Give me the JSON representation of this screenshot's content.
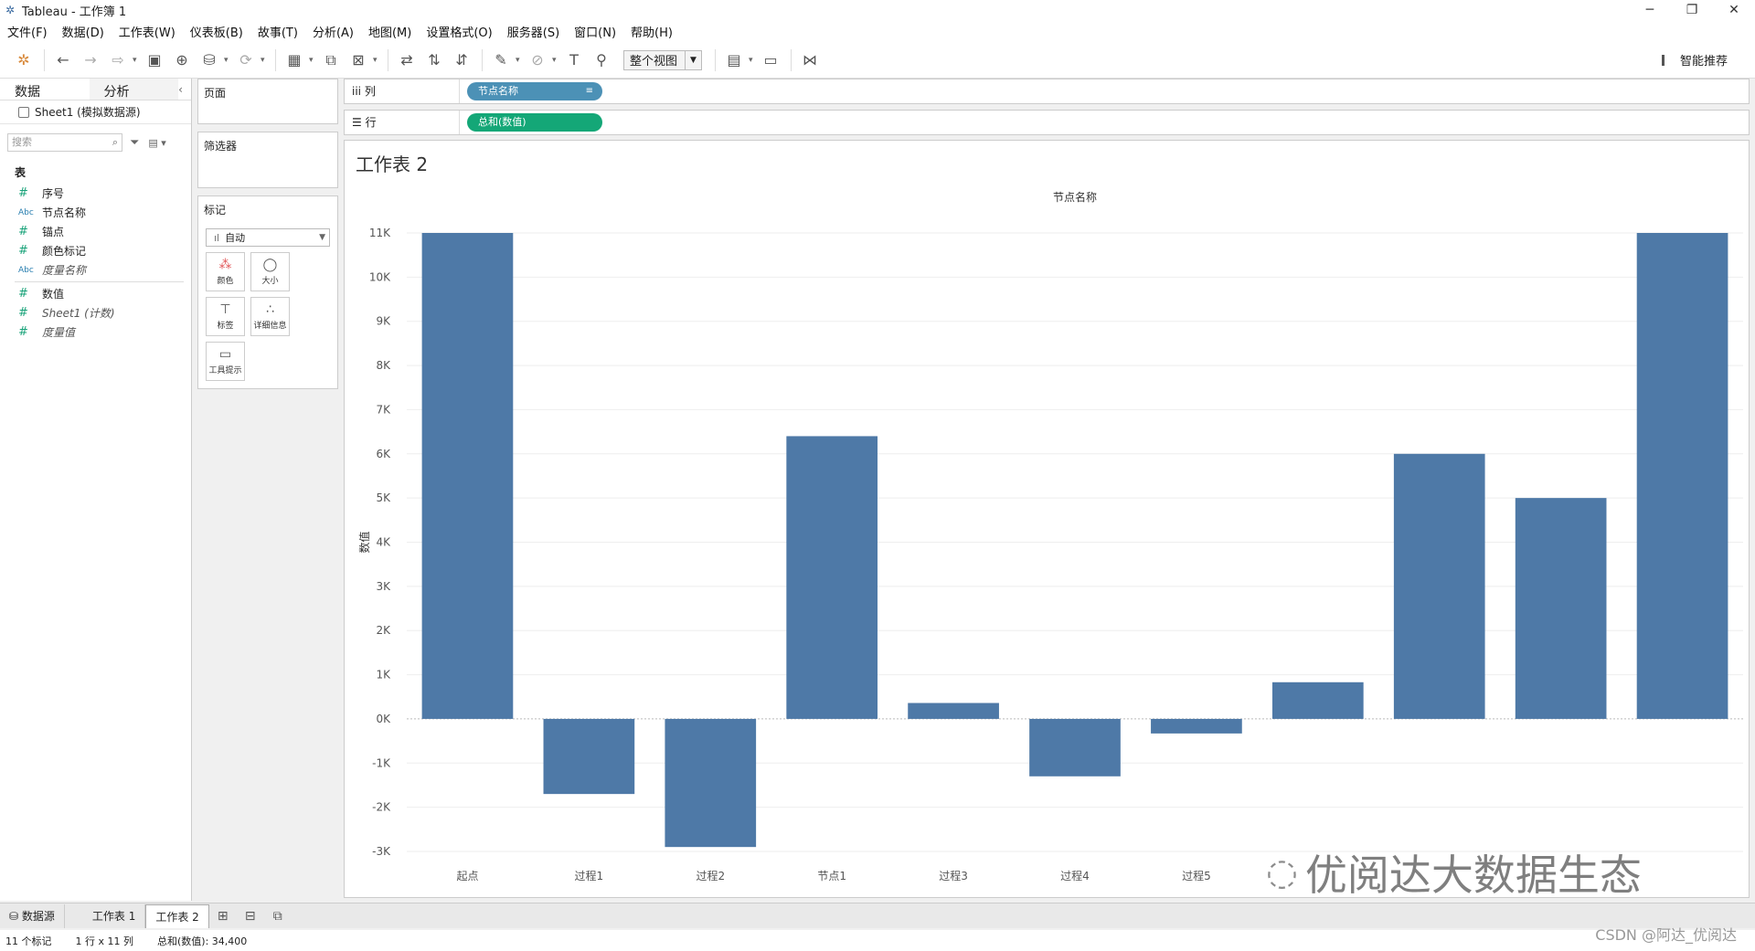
{
  "window": {
    "title": "Tableau - 工作簿 1",
    "controls": [
      "─",
      "❐",
      "✕"
    ]
  },
  "menu": [
    "文件(F)",
    "数据(D)",
    "工作表(W)",
    "仪表板(B)",
    "故事(T)",
    "分析(A)",
    "地图(M)",
    "设置格式(O)",
    "服务器(S)",
    "窗口(N)",
    "帮助(H)"
  ],
  "toolbar": {
    "view_select": "整个视图",
    "smart": "智能推荐"
  },
  "left_panel": {
    "tabs": [
      "数据",
      "分析"
    ],
    "datasource": "Sheet1 (模拟数据源)",
    "search_placeholder": "搜索",
    "section_title": "表",
    "dimensions": [
      {
        "type": "#",
        "name": "序号",
        "italic": false
      },
      {
        "type": "Abc",
        "name": "节点名称",
        "italic": false
      },
      {
        "type": "#",
        "name": "锚点",
        "italic": false
      },
      {
        "type": "#",
        "name": "颜色标记",
        "italic": false
      },
      {
        "type": "Abc",
        "name": "度量名称",
        "italic": true
      }
    ],
    "measures": [
      {
        "type": "#",
        "name": "数值",
        "italic": false
      },
      {
        "type": "#",
        "name": "Sheet1 (计数)",
        "italic": true
      },
      {
        "type": "#",
        "name": "度量值",
        "italic": true
      }
    ]
  },
  "cards": {
    "pages": "页面",
    "filters": "筛选器",
    "marks": "标记",
    "marks_type": "自动",
    "marks_buttons": [
      {
        "icon": "●",
        "label": "颜色"
      },
      {
        "icon": "◯",
        "label": "大小"
      },
      {
        "icon": "T",
        "label": "标签"
      },
      {
        "icon": "∴",
        "label": "详细信息"
      },
      {
        "icon": "▭",
        "label": "工具提示"
      }
    ]
  },
  "shelves": {
    "columns_label": "iii 列",
    "columns_pill": "节点名称",
    "rows_label": "☰ 行",
    "rows_pill": "总和(数值)"
  },
  "sheet_title": "工作表 2",
  "chart_data": {
    "type": "bar",
    "title": "节点名称",
    "ylabel": "数值",
    "categories": [
      "起点",
      "过程1",
      "过程2",
      "节点1",
      "过程3",
      "过程4",
      "过程5",
      "",
      "",
      "",
      ""
    ],
    "values": [
      11000,
      -1700,
      -2900,
      6400,
      360,
      -1300,
      -330,
      830,
      6000,
      5000,
      11000
    ],
    "ylim": [
      -3000,
      11000
    ],
    "yticks": [
      "-3K",
      "-2K",
      "-1K",
      "0K",
      "1K",
      "2K",
      "3K",
      "4K",
      "5K",
      "6K",
      "7K",
      "8K",
      "9K",
      "10K",
      "11K"
    ],
    "ytick_values": [
      -3000,
      -2000,
      -1000,
      0,
      1000,
      2000,
      3000,
      4000,
      5000,
      6000,
      7000,
      8000,
      9000,
      10000,
      11000
    ],
    "bar_color": "#4e79a7",
    "grid": true
  },
  "bottom_tabs": {
    "datasource": "数据源",
    "sheets": [
      "工作表 1",
      "工作表 2"
    ],
    "active": "工作表 2"
  },
  "status": [
    "11 个标记",
    "1 行 x 11 列",
    "总和(数值): 34,400"
  ],
  "watermark": "优阅达大数据生态",
  "csdn": "CSDN @阿达_优阅达"
}
